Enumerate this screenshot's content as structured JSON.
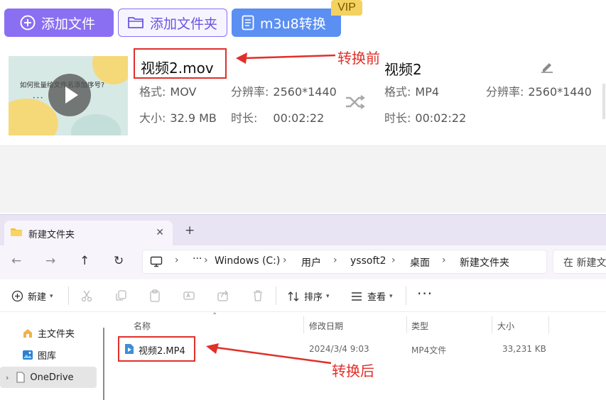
{
  "converter": {
    "toolbar": {
      "add_file_label": "添加文件",
      "add_folder_label": "添加文件夹",
      "m3u8_label": "m3u8转换",
      "vip_badge": "VIP"
    },
    "file": {
      "thumbnail_title": "如何批量给文件名添加序号?",
      "source": {
        "name": "视频2.mov",
        "format_label": "格式:",
        "format_value": "MOV",
        "resolution_label": "分辨率:",
        "resolution_value": "2560*1440",
        "size_label": "大小:",
        "size_value": "32.9 MB",
        "duration_label": "时长:",
        "duration_value": "00:02:22"
      },
      "output": {
        "name": "视频2",
        "format_label": "格式:",
        "format_value": "MP4",
        "resolution_label": "分辨率:",
        "resolution_value": "2560*1440",
        "duration_label": "时长:",
        "duration_value": "00:02:22"
      }
    },
    "annotation_before": "转换前"
  },
  "explorer": {
    "tab_title": "新建文件夹",
    "breadcrumb": [
      "Windows (C:)",
      "用户",
      "yssoft2",
      "桌面",
      "新建文件夹"
    ],
    "search_placeholder": "在 新建文",
    "commands": {
      "new_label": "新建",
      "sort_label": "排序",
      "view_label": "查看",
      "more_label": "···"
    },
    "nav": [
      {
        "label": "主文件夹"
      },
      {
        "label": "图库"
      },
      {
        "label": "OneDrive"
      }
    ],
    "columns": [
      "名称",
      "修改日期",
      "类型",
      "大小"
    ],
    "files": [
      {
        "name": "视频2.MP4",
        "modified": "2024/3/4 9:03",
        "type": "MP4文件",
        "size": "33,231 KB"
      }
    ],
    "annotation_after": "转换后"
  },
  "colors": {
    "accent_purple": "#8a6ff2",
    "accent_blue": "#5b8ff2",
    "annotation_red": "#e0302a",
    "vip_gold": "#f4d25f"
  }
}
